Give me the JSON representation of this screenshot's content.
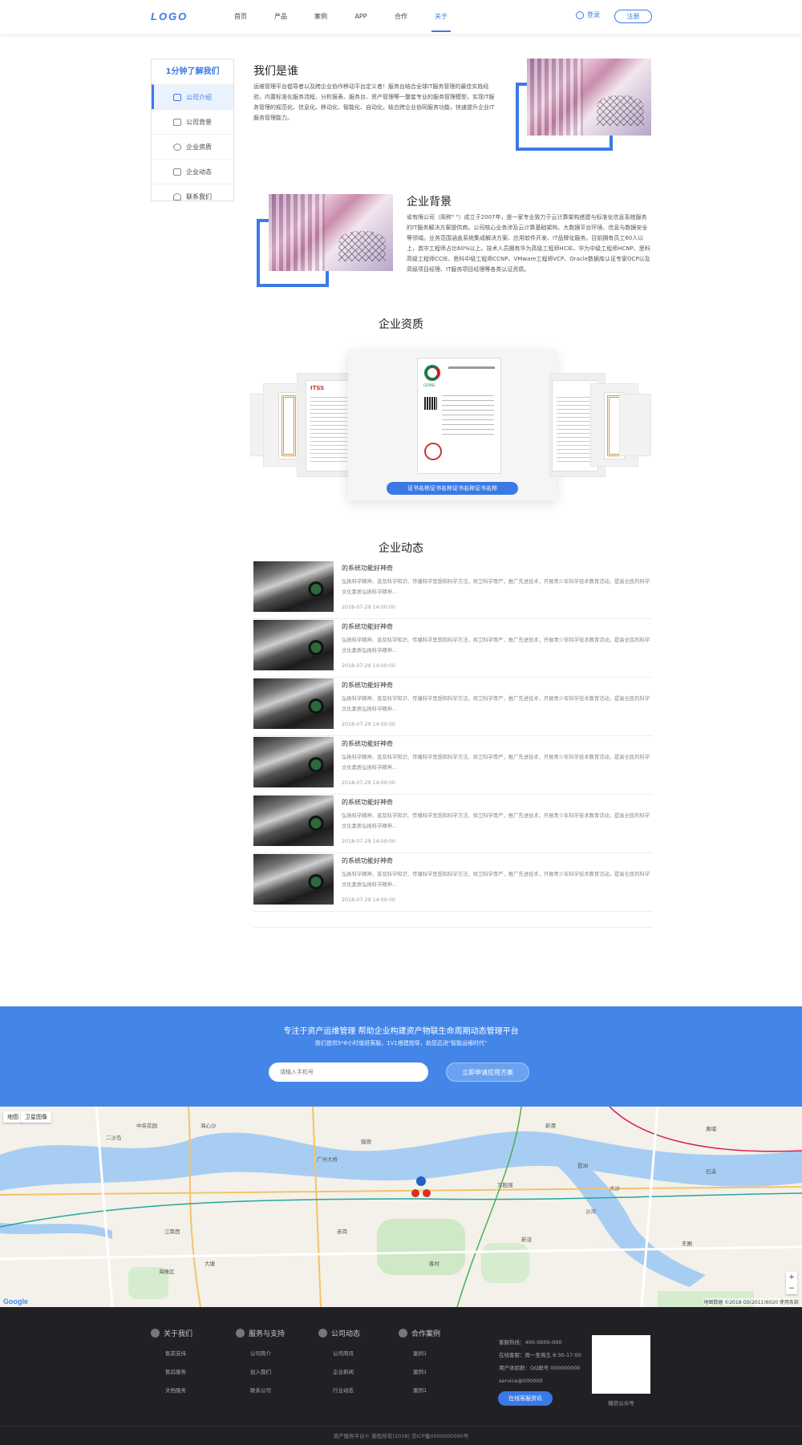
{
  "header": {
    "logo": "LOGO",
    "nav": [
      "首页",
      "产品",
      "案例",
      "APP",
      "合作",
      "关于"
    ],
    "active_nav": "关于",
    "login": "登录",
    "register": "注册"
  },
  "sidebar": {
    "title": "1分钟了解我们",
    "items": [
      "公司介绍",
      "公司背景",
      "企业资质",
      "企业动态",
      "联系我们"
    ]
  },
  "about": {
    "title": "我们是谁",
    "text": "运维管理平台倡导者以及跨企业协作移动平台定义者！服务台结合全球IT服务管理的最佳实践经验，内置标准化服务流程、分析报表、服务台、资产管理等一整套专业的服务管理模型，实现IT服务管理的规范化、信息化、移动化、智能化、自动化，结合跨企业协同服务功能，快速提升企业IT服务管理能力。"
  },
  "background": {
    "title": "企业背景",
    "text": "省有限公司（简称\"  \"）成立于2007年，是一家专业致力于云计算架构搭建与标准化信息系统服务的IT服务解决方案提供商。公司核心业务涉及云计算基础架构、大数据平台环境、信息与数据安全等领域。业务范围涵盖系统集成解决方案、应用软件开发、IT品牌化服务。目前拥有员工60人以上，其中工程师占比60%以上。技术人员拥有华为高级工程师HCIE、华为中级工程师HCNP、思科高级工程师CCIE、思科中级工程师CCNP、VMware工程师VCP、Oracle数据库认证专家OCP以及高级项目经理、IT服务项目经理等各类认证资质。"
  },
  "qualification": {
    "title": "企业资质",
    "cert_button": "证书名称证书名称证书名称证书名称",
    "cert_side_label": "ITSS",
    "cert_brand": "CEPREI"
  },
  "news": {
    "title": "企业动态",
    "items": [
      {
        "title": "的系统功能好神奇",
        "desc": "弘扬科学精神、普及科学知识、传播科学思想和科学方法，捍卫科学尊严，推广先进技术，开展青少年科学技术教育活动，提高全民的科学文化素质弘扬科学精神...",
        "time": "2018-07-29  14:00:00"
      },
      {
        "title": "的系统功能好神奇",
        "desc": "弘扬科学精神、普及科学知识、传播科学思想和科学方法，捍卫科学尊严，推广先进技术，开展青少年科学技术教育活动，提高全民的科学文化素质弘扬科学精神...",
        "time": "2018-07-29  14:00:00"
      },
      {
        "title": "的系统功能好神奇",
        "desc": "弘扬科学精神、普及科学知识、传播科学思想和科学方法，捍卫科学尊严，推广先进技术，开展青少年科学技术教育活动，提高全民的科学文化素质弘扬科学精神...",
        "time": "2018-07-29  14:00:00"
      },
      {
        "title": "的系统功能好神奇",
        "desc": "弘扬科学精神、普及科学知识、传播科学思想和科学方法，捍卫科学尊严，推广先进技术，开展青少年科学技术教育活动，提高全民的科学文化素质弘扬科学精神...",
        "time": "2018-07-29  14:00:00"
      },
      {
        "title": "的系统功能好神奇",
        "desc": "弘扬科学精神、普及科学知识、传播科学思想和科学方法，捍卫科学尊严，推广先进技术，开展青少年科学技术教育活动，提高全民的科学文化素质弘扬科学精神...",
        "time": "2018-07-29  14:00:00"
      },
      {
        "title": "的系统功能好神奇",
        "desc": "弘扬科学精神、普及科学知识、传播科学思想和科学方法，捍卫科学尊严，推广先进技术，开展青少年科学技术教育活动，提高全民的科学文化素质弘扬科学精神...",
        "time": "2018-07-29  14:00:00"
      }
    ]
  },
  "banner": {
    "title": "专注于资产运维管理 帮助企业构建资产物联生命周期动态管理平台",
    "subtitle": "我们提供5*8小时值班客服，1V1搭建指导，助您迈进\"智能运维时代\"",
    "phone_placeholder": "请输入手机号",
    "apply_button": "立即申请应用方案"
  },
  "map": {
    "tab_map": "地图",
    "tab_satellite": "卫星图像",
    "labels": [
      "二沙岛",
      "海心沙",
      "中央花园",
      "琶洲",
      "新港",
      "猎德",
      "大塘",
      "赤岗",
      "客村",
      "石溪",
      "江南西",
      "海珠区",
      "大沙",
      "新滘",
      "黄埔",
      "东圃",
      "沙河",
      "广州大桥",
      "万胜围"
    ],
    "credit": "地图数据 ©2018 GS(2011)6020  使用条款",
    "google": "Google",
    "zoom_in": "+",
    "zoom_out": "−"
  },
  "footer": {
    "columns": [
      {
        "title": "关于我们",
        "links": [
          "售前支持",
          "售后服务",
          "文档服务"
        ]
      },
      {
        "title": "服务与支持",
        "links": [
          "公司简介",
          "加入我们",
          "联系公司"
        ]
      },
      {
        "title": "公司动态",
        "links": [
          "公司简讯",
          "企业新闻",
          "行业动态"
        ]
      },
      {
        "title": "合作案例",
        "links": [
          "案例1",
          "案例1",
          "案例1"
        ]
      }
    ],
    "contact": [
      "客服热线：400-0000-000",
      "在线客服：周一至周五 8:30-17:00",
      "用户体验群：QQ群号 000000000",
      "service@000000"
    ],
    "service_button": "在线客服资讯",
    "qr_caption": "微信公众号",
    "copyright": "资产服务平台©    版权所有(2018)    京ICP备0000000000号"
  },
  "colors": {
    "accent": "#3b7ae6",
    "banner": "#4486e8",
    "footer": "#1f2124"
  }
}
